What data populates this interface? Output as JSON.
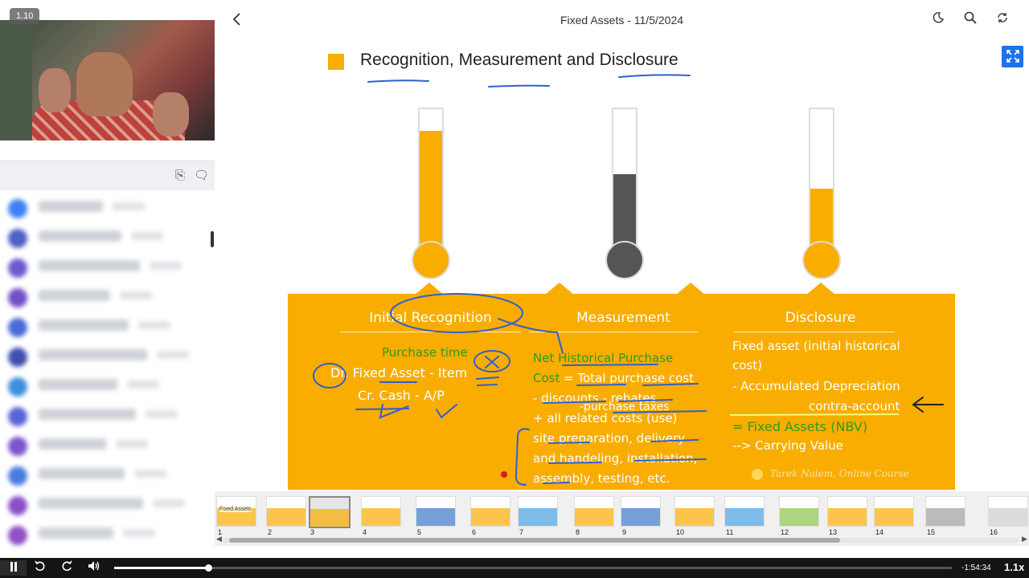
{
  "video": {
    "speed_badge": "1.10"
  },
  "header": {
    "title": "Fixed Assets - 11/5/2024"
  },
  "icons": {
    "back": "chevron-left-icon",
    "theme": "moon-icon",
    "search": "search-icon",
    "sync": "sync-icon",
    "fullscreen": "expand-icon",
    "copy": "copy-icon",
    "chat": "chat-icon"
  },
  "participants": [
    {
      "color": "#3b82f6"
    },
    {
      "color": "#4f5fc4"
    },
    {
      "color": "#6d5ad0"
    },
    {
      "color": "#7250c8"
    },
    {
      "color": "#4b6bd8"
    },
    {
      "color": "#3f4fb0"
    },
    {
      "color": "#3c8ee0"
    },
    {
      "color": "#5a63d6"
    },
    {
      "color": "#7a55cf"
    },
    {
      "color": "#4a7be0"
    },
    {
      "color": "#8a4fc7"
    },
    {
      "color": "#9150c5"
    }
  ],
  "slide": {
    "title": "Recognition, Measurement and Disclosure",
    "accent_color": "#f9ad00",
    "thermometers": [
      {
        "level": 0.85,
        "color": "#f9ad00"
      },
      {
        "level": 0.55,
        "color": "#555555"
      },
      {
        "level": 0.45,
        "color": "#f9ad00"
      }
    ],
    "columns": {
      "initial": {
        "heading": "Initial Recognition",
        "line1": "Purchase time",
        "line2": "Dr. Fixed Asset - Item",
        "line3": "Cr. Cash - A/P"
      },
      "measurement": {
        "heading": "Measurement",
        "line1_prefix": "Net ",
        "line1_main": "Historical Purchase",
        "line2_green": "Cost",
        "line2_white": " = Total purchase cost",
        "line3": "- discounts - rebates",
        "line3b": "-purchase taxes",
        "line4": "+ all related costs (use)",
        "line5": "site preparation, delivery",
        "line6": "and handeling, installation,",
        "line7": "assembly, testing, etc."
      },
      "disclosure": {
        "heading": "Disclosure",
        "line1": "Fixed asset (initial historical",
        "line2": "cost)",
        "line3": "- Accumulated Depreciation",
        "line4": "contra-account",
        "line5": "= Fixed Assets (NBV)",
        "line6": "--> Carrying Value"
      }
    },
    "watermark": "Tarek Naiem, Online Course"
  },
  "thumbnails": {
    "selected": "3",
    "numbers": [
      "1",
      "2",
      "3",
      "4",
      "5",
      "6",
      "7",
      "8",
      "9",
      "10",
      "11",
      "12",
      "13",
      "14",
      "15",
      "16"
    ],
    "first_label": "Fixed Assets"
  },
  "player": {
    "time_remaining": "-1:54:34",
    "speed": "1.1x",
    "progress_fraction": 0.112
  }
}
